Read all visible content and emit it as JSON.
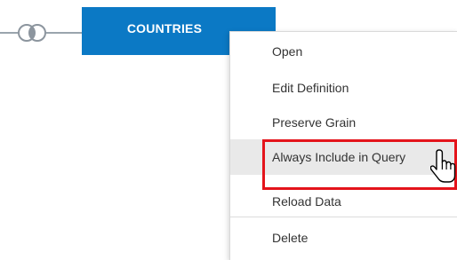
{
  "entity": {
    "label": "COUNTRIES",
    "color": "#0b79c5"
  },
  "join": {
    "icon": "venn-join-icon"
  },
  "context_menu": {
    "items": [
      {
        "label": "Open",
        "hovered": false
      },
      {
        "label": "Edit Definition",
        "hovered": false
      },
      {
        "label": "Preserve Grain",
        "hovered": false
      },
      {
        "label": "Always Include in Query",
        "hovered": true
      },
      {
        "label": "Reload Data",
        "hovered": false
      },
      {
        "label": "Delete",
        "hovered": false
      }
    ]
  },
  "annotation": {
    "color": "#e4141b"
  },
  "cursor": {
    "icon": "hand-pointer-icon"
  }
}
